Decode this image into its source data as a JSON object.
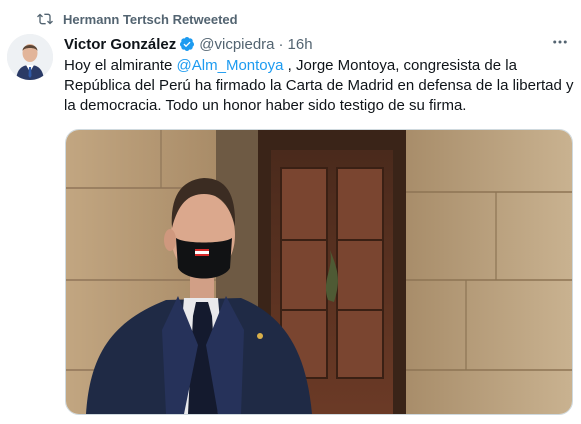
{
  "retweet": {
    "icon": "retweet-icon",
    "text": "Hermann Tertsch Retweeted"
  },
  "author": {
    "name": "Victor González",
    "handle": "@vicpiedra",
    "separator": "·",
    "time": "16h",
    "verified_icon": "verified-badge-icon",
    "avatar_icon": "avatar"
  },
  "tweet": {
    "text_before": "Hoy el almirante ",
    "mention": "@Alm_Montoya",
    "text_after": " , Jorge Montoya, congresista de la República del Perú ha firmado la Carta de Madrid en defensa de la libertad y la democracia. Todo un honor haber sido testigo de su firma."
  },
  "menu": {
    "more_icon": "more-options-icon",
    "more_label": "···"
  },
  "colors": {
    "accent": "#1d9bf0",
    "secondary_text": "#536471",
    "primary_text": "#0f1419"
  }
}
